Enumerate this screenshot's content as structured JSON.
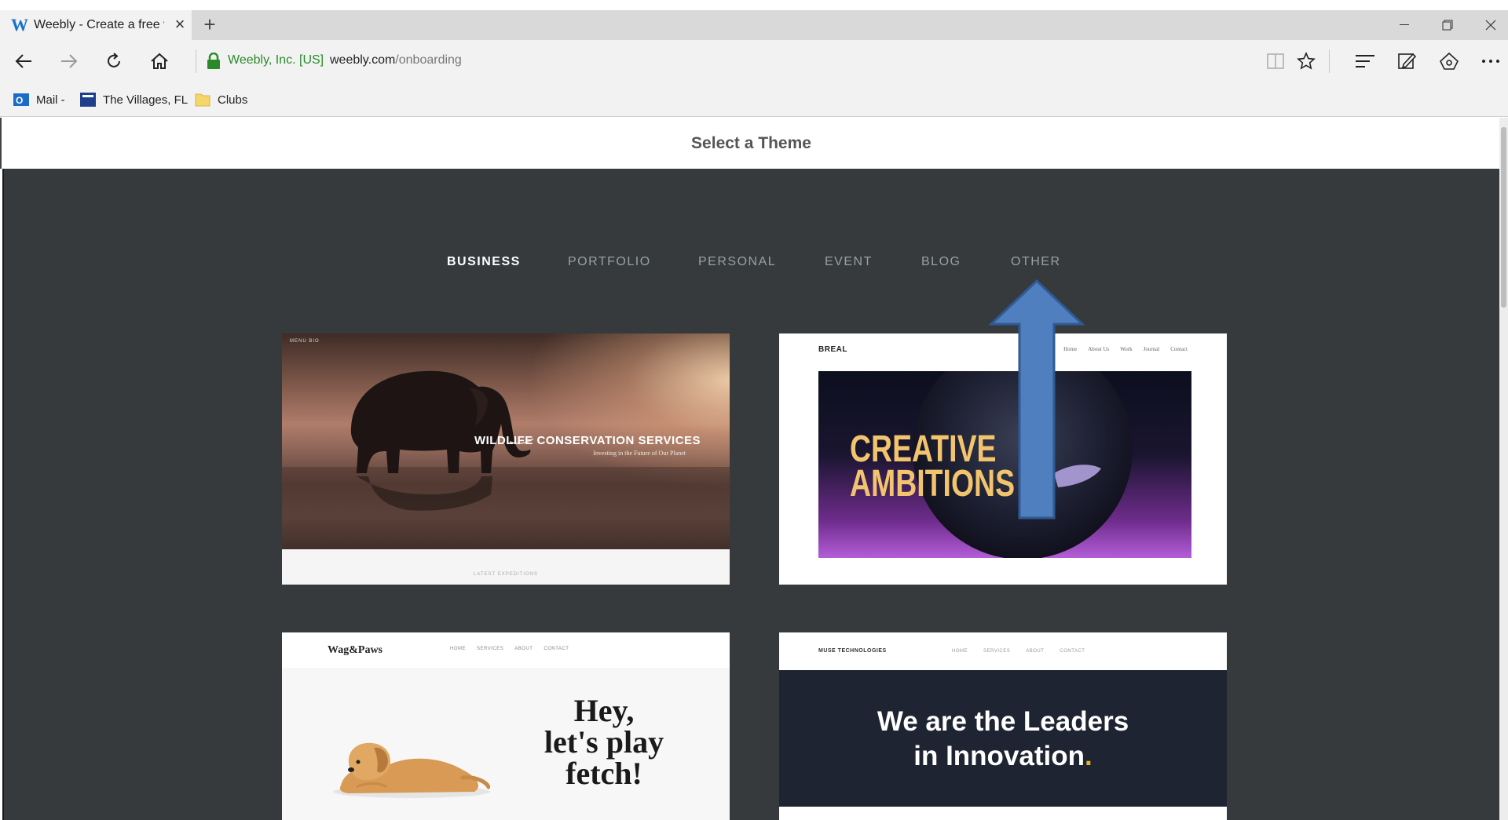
{
  "browser": {
    "tab": {
      "title": "Weebly - Create a free w"
    },
    "address": {
      "site_identity": "Weebly, Inc. [US]",
      "domain": "weebly.com",
      "path": "/onboarding"
    },
    "favorites": [
      {
        "label": "Mail -",
        "icon": "outlook-icon"
      },
      {
        "label": "The Villages, FL",
        "icon": "site-favicon"
      },
      {
        "label": "Clubs",
        "icon": "folder-icon"
      }
    ]
  },
  "page": {
    "title": "Select a Theme",
    "categories": [
      {
        "label": "BUSINESS",
        "active": true
      },
      {
        "label": "PORTFOLIO",
        "active": false
      },
      {
        "label": "PERSONAL",
        "active": false
      },
      {
        "label": "EVENT",
        "active": false
      },
      {
        "label": "BLOG",
        "active": false
      },
      {
        "label": "OTHER",
        "active": false
      }
    ],
    "themes": [
      {
        "nav": "MENU   BIO",
        "headline": "WILDLIFE CONSERVATION SERVICES",
        "subtitle": "Investing in the Future of Our Planet",
        "footer": "LATEST EXPEDITIONS"
      },
      {
        "logo": "BREAL",
        "menu": [
          "Home",
          "About Us",
          "Work",
          "Journal",
          "Contact"
        ],
        "headline_line1": "CREATIVE",
        "headline_line2": "AMBITIONS"
      },
      {
        "logo": "Wag&Paws",
        "menu": [
          "HOME",
          "SERVICES",
          "ABOUT",
          "CONTACT"
        ],
        "headline_line1": "Hey,",
        "headline_line2": "let's play",
        "headline_line3": "fetch!"
      },
      {
        "logo": "MUSE TECHNOLOGIES",
        "menu": [
          "HOME",
          "SERVICES",
          "ABOUT",
          "CONTACT"
        ],
        "headline_line1": "We are the Leaders",
        "headline_line2": "in Innovation",
        "headline_dot": "."
      }
    ]
  },
  "colors": {
    "content_bg": "#363a3c",
    "annotation_arrow": "#4f7fbf",
    "site_identity": "#2a8a2a",
    "creative_text": "#f2c46e",
    "muse_dot": "#e6b422"
  }
}
